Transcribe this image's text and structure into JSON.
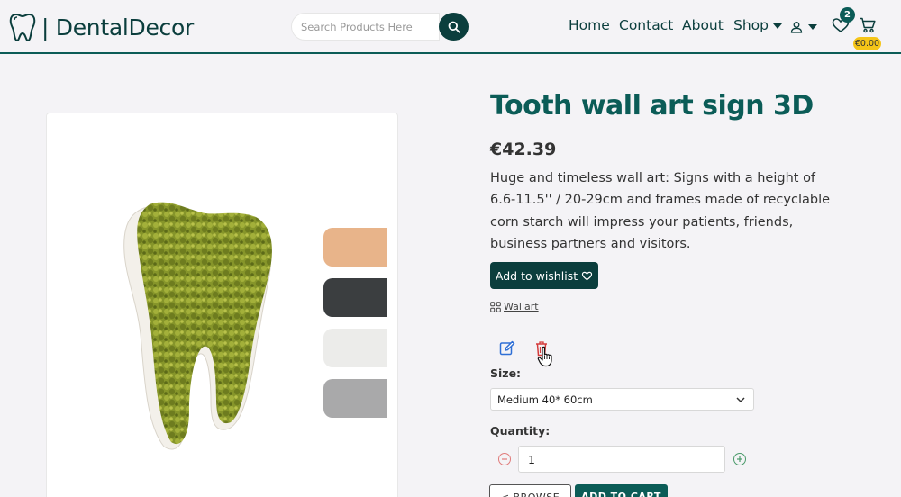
{
  "header": {
    "brand": "| DentalDecor",
    "search": {
      "placeholder": "Search Products Here",
      "value": ""
    },
    "nav": {
      "home": "Home",
      "contact": "Contact",
      "about": "About",
      "shop": "Shop"
    },
    "wishlist_count": "2",
    "cart_total": "€0.00"
  },
  "product": {
    "title": "Tooth wall art sign 3D",
    "price": "€42.39",
    "description": "Huge and timeless wall art: Signs with a height of 6.6-11.5'' / 20-29cm and frames made of recyclable corn starch will impress your patients, friends, business partners and visitors.",
    "wishlist_button": "Add to wishlist",
    "category": "Wallart",
    "swatch_colors": [
      "#e8b48a",
      "#3b3e40",
      "#ececea",
      "#a9a9aa"
    ]
  },
  "options": {
    "size_label": "Size:",
    "size_value": "Medium 40* 60cm",
    "quantity_label": "Quantity:",
    "quantity_value": "1"
  },
  "actions": {
    "browse": "< BROWSE",
    "add_to_cart": "ADD TO CART"
  },
  "colors": {
    "brand": "#0b3e3d",
    "accent": "#0b5c57",
    "badge": "#f5c518"
  }
}
